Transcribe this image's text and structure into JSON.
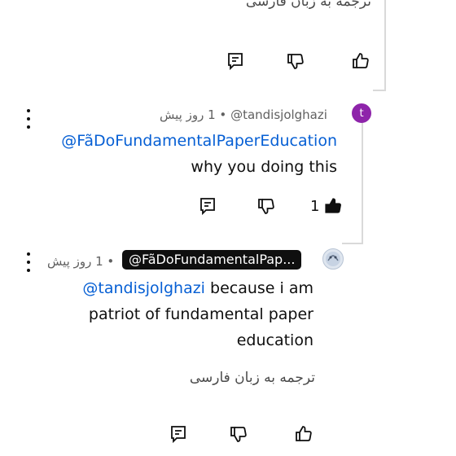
{
  "top_comment": {
    "translate_label": "ترجمه به زبان فارسی"
  },
  "reply1": {
    "avatar_letter": "t",
    "avatar_color": "#8e24aa",
    "author": "@tandisjolghazi",
    "separator": "•",
    "time": "1 روز پیش",
    "mention": "@FãDoFundamentalPaperEducation",
    "text": "why you doing this",
    "like_count": "1"
  },
  "reply2": {
    "author": "@FãDoFundamentalPap...",
    "separator": "•",
    "time": "1 روز پیش",
    "mention": "@tandisjolghazi",
    "text_line1": " because i am",
    "text_line2": "patriot of fundamental paper",
    "text_line3": "education",
    "translate_label": "ترجمه به زبان فارسی"
  },
  "colors": {
    "link_blue": "#065fd4",
    "chip_black": "#0f0f0f",
    "meta_gray": "#606060"
  }
}
